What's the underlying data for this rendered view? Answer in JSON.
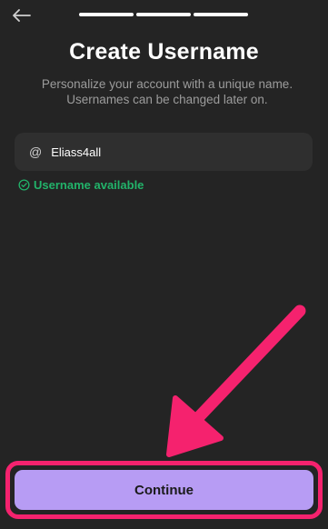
{
  "header": {
    "back_icon": "arrow-left-icon",
    "progress_steps": 3
  },
  "title": "Create Username",
  "subtitle": "Personalize your account with a unique name. Usernames can be changed later on.",
  "username_field": {
    "prefix": "@",
    "value": "Eliass4all"
  },
  "status": {
    "icon": "check-circle-icon",
    "text": "Username available",
    "color": "#22b36a"
  },
  "continue_button": {
    "label": "Continue",
    "color": "#b79cf4"
  },
  "annotation": {
    "color": "#f5226e"
  }
}
